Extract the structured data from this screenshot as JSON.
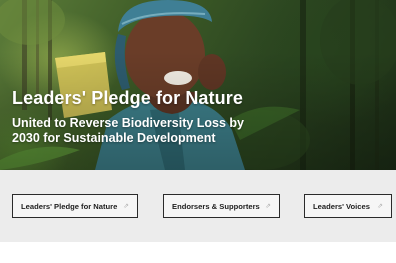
{
  "hero": {
    "title": "Leaders' Pledge for Nature",
    "subtitle": "United to Reverse Biodiversity Loss by 2030 for Sustainable Development"
  },
  "nav": {
    "items": [
      {
        "label": "Leaders' Pledge for Nature",
        "icon": "arrow-up-right-icon"
      },
      {
        "label": "Endorsers & Supporters",
        "icon": "arrow-up-right-icon"
      },
      {
        "label": "Leaders' Voices",
        "icon": "arrow-up-right-icon"
      }
    ]
  },
  "colors": {
    "strip_bg": "#ececec",
    "button_border": "#2b2b2b",
    "hero_text": "#ffffff"
  }
}
